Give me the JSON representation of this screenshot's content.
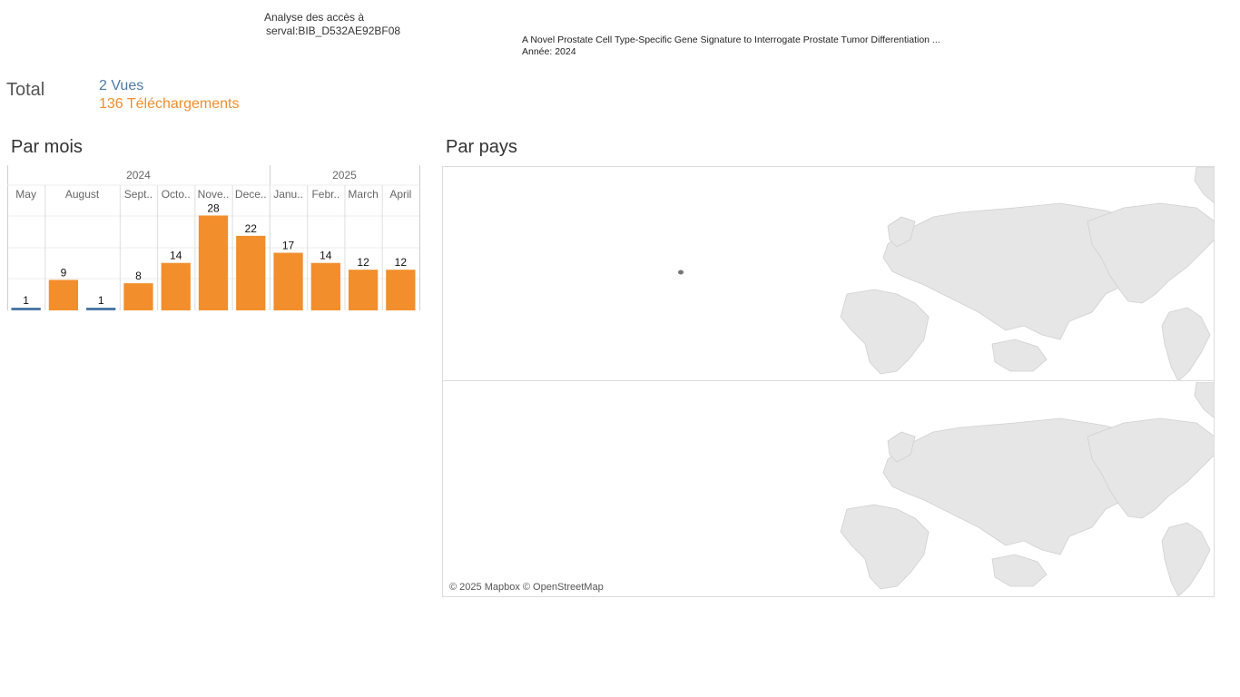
{
  "header": {
    "title_line1": "Analyse des accès à",
    "title_line2": "serval:BIB_D532AE92BF08",
    "publication_title": "A Novel Prostate Cell Type-Specific Gene Signature to Interrogate Prostate Tumor Differentiation ...",
    "publication_year": "Année: 2024"
  },
  "totals": {
    "label": "Total",
    "views": "2 Vues",
    "downloads": "136 Téléchargements"
  },
  "sections": {
    "by_month": "Par mois",
    "by_country": "Par pays"
  },
  "map": {
    "attribution": "© 2025 Mapbox © OpenStreetMap"
  },
  "colors": {
    "views": "#4e79a7",
    "downloads": "#f28e2b",
    "highlight_country": "#777777",
    "land": "#e6e6e6"
  },
  "chart_data": {
    "type": "bar",
    "years": [
      {
        "label": "2024",
        "months": [
          "May",
          "August",
          "Sept..",
          "Octo..",
          "Nove..",
          "Dece.."
        ]
      },
      {
        "label": "2025",
        "months": [
          "Janu..",
          "Febr..",
          "March",
          "April"
        ]
      }
    ],
    "columns": [
      {
        "label": "May",
        "year": "2024",
        "series": "views",
        "value": 1
      },
      {
        "label": "August",
        "year": "2024",
        "series": "downloads",
        "value": 9
      },
      {
        "label": "August",
        "year": "2024",
        "series": "views",
        "value": 1
      },
      {
        "label": "Sept..",
        "year": "2024",
        "series": "downloads",
        "value": 8
      },
      {
        "label": "Octo..",
        "year": "2024",
        "series": "downloads",
        "value": 14
      },
      {
        "label": "Nove..",
        "year": "2024",
        "series": "downloads",
        "value": 28
      },
      {
        "label": "Dece..",
        "year": "2024",
        "series": "downloads",
        "value": 22
      },
      {
        "label": "Janu..",
        "year": "2025",
        "series": "downloads",
        "value": 17
      },
      {
        "label": "Febr..",
        "year": "2025",
        "series": "downloads",
        "value": 14
      },
      {
        "label": "March",
        "year": "2025",
        "series": "downloads",
        "value": 12
      },
      {
        "label": "April",
        "year": "2025",
        "series": "downloads",
        "value": 12
      }
    ],
    "ylim": [
      0,
      30
    ],
    "grid": true
  }
}
